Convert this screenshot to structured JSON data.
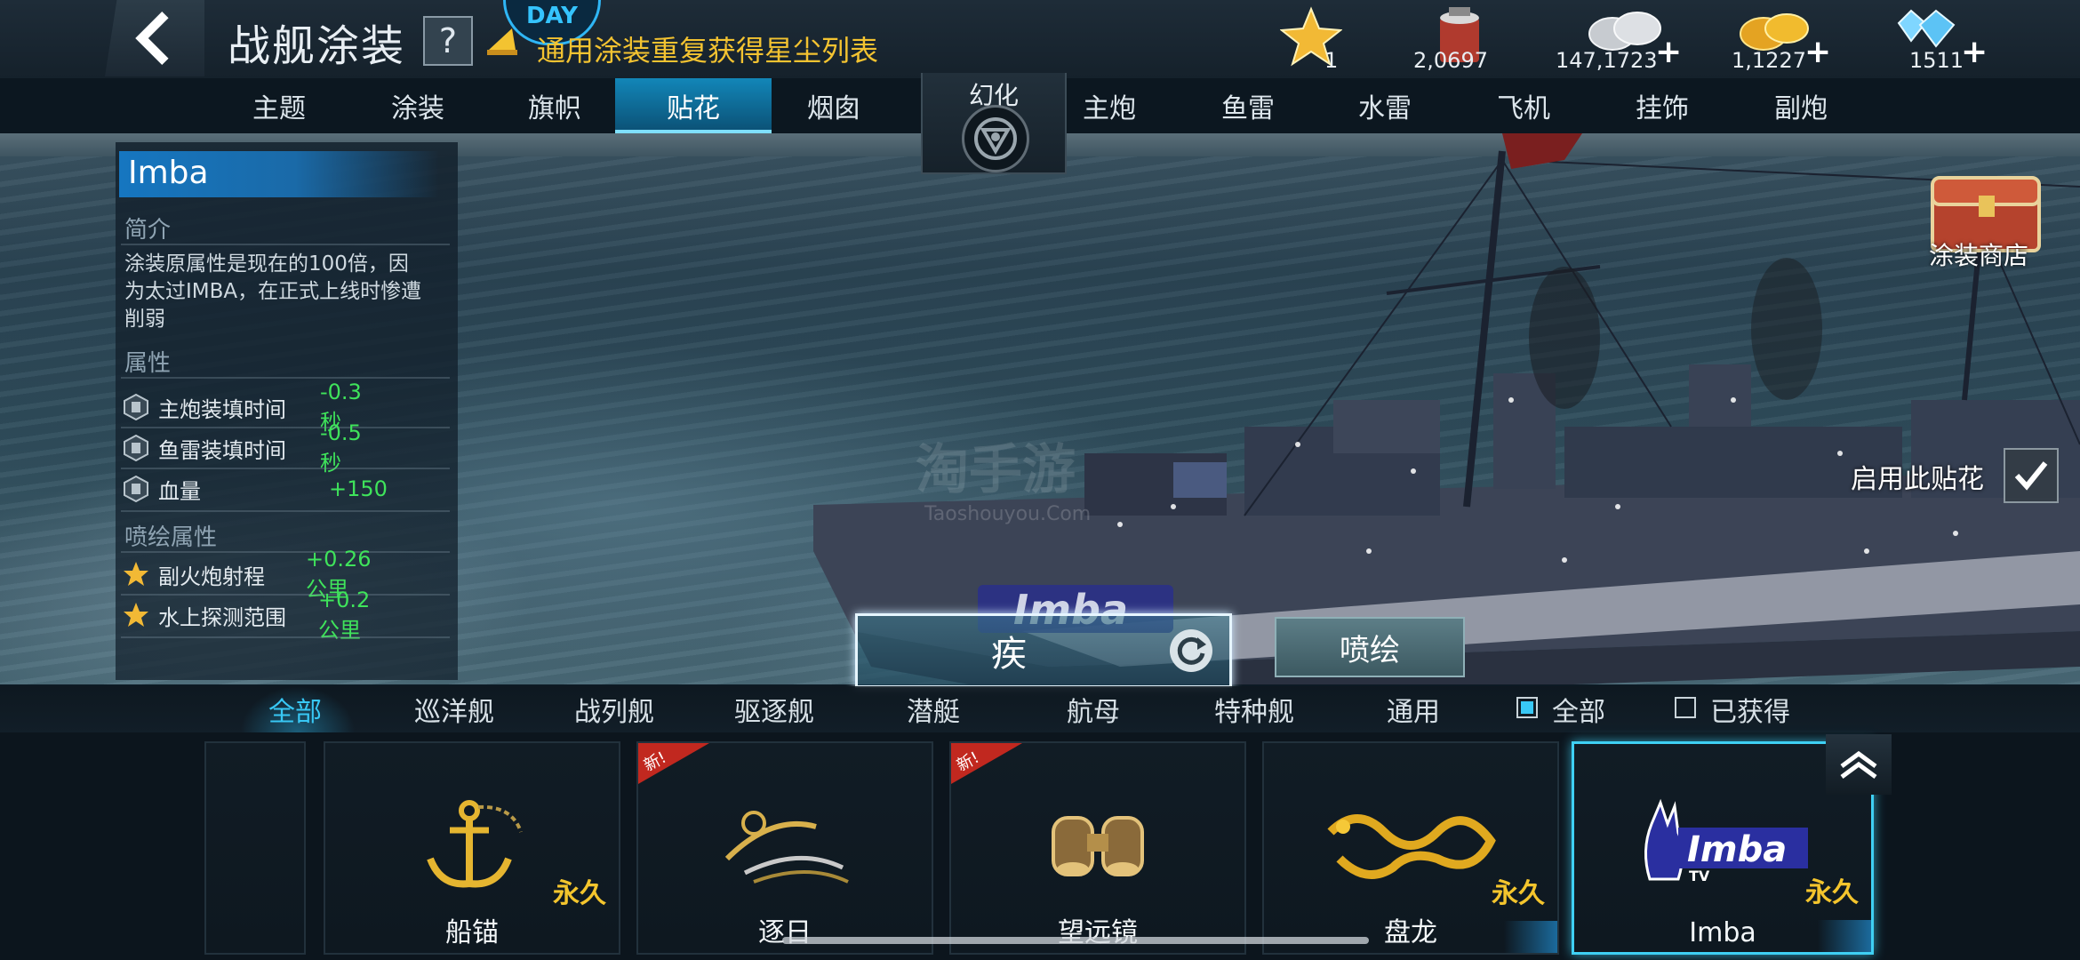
{
  "header": {
    "title": "战舰涂装",
    "help_label": "?",
    "event_badge": "DAY",
    "notice": "通用涂装重复获得星尘列表"
  },
  "resources": [
    {
      "icon": "star-icon",
      "value": "1",
      "plus": ""
    },
    {
      "icon": "paint-bucket-icon",
      "value": "2,0697",
      "plus": ""
    },
    {
      "icon": "silver-coins-icon",
      "value": "147,1723",
      "plus": "+"
    },
    {
      "icon": "gold-coins-icon",
      "value": "1,1227",
      "plus": "+"
    },
    {
      "icon": "diamonds-icon",
      "value": "1511",
      "plus": "+"
    }
  ],
  "tabs": {
    "left": [
      "主题",
      "涂装",
      "旗帜",
      "贴花",
      "烟囱"
    ],
    "morph": "幻化",
    "right": [
      "主炮",
      "鱼雷",
      "水雷",
      "飞机",
      "挂饰",
      "副炮"
    ],
    "active": "贴花"
  },
  "info": {
    "name": "Imba",
    "intro_heading": "简介",
    "intro": "涂装原属性是现在的100倍，因为太过IMBA，在正式上线时惨遭削弱",
    "attr_heading": "属性",
    "attrs": [
      {
        "label": "主炮装填时间",
        "value": "-0.3 秒"
      },
      {
        "label": "鱼雷装填时间",
        "value": "-0.5 秒"
      },
      {
        "label": "血量",
        "value": "+150"
      }
    ],
    "spray_heading": "喷绘属性",
    "spray_attrs": [
      {
        "label": "副火炮射程",
        "value": "+0.26 公里"
      },
      {
        "label": "水上探测范围",
        "value": "+0.2 公里"
      }
    ]
  },
  "shop": {
    "label": "涂装商店"
  },
  "enable": {
    "label": "启用此贴花",
    "checked": true
  },
  "watermark": {
    "text": "淘手游",
    "sub": "Taoshouyou.Com"
  },
  "actions": {
    "speed_label": "疾",
    "spray_label": "喷绘"
  },
  "filters": {
    "ship_types": [
      "全部",
      "巡洋舰",
      "战列舰",
      "驱逐舰",
      "潜艇",
      "航母",
      "特种舰",
      "通用"
    ],
    "active": "全部",
    "ownership": [
      {
        "label": "全部",
        "checked": true
      },
      {
        "label": "已获得",
        "checked": false
      }
    ]
  },
  "items": [
    {
      "name": "",
      "tag": "",
      "new": false
    },
    {
      "name": "船锚",
      "tag": "永久",
      "new": false,
      "icon": "anchor-icon"
    },
    {
      "name": "逐日",
      "tag": "",
      "new": true,
      "new_label": "新!",
      "icon": "sun-chaser-icon"
    },
    {
      "name": "望远镜",
      "tag": "",
      "new": true,
      "new_label": "新!",
      "icon": "binoculars-icon"
    },
    {
      "name": "盘龙",
      "tag": "永久",
      "new": false,
      "icon": "dragon-icon"
    },
    {
      "name": "Imba",
      "tag": "永久",
      "new": false,
      "selected": true,
      "icon": "imba-logo-icon",
      "logo_text": "Imba",
      "logo_sub": "TV"
    }
  ],
  "colors": {
    "accent": "#38c8f5",
    "gold": "#f4c52d",
    "positive": "#3fe35b",
    "active_tab": "#1286b8"
  }
}
